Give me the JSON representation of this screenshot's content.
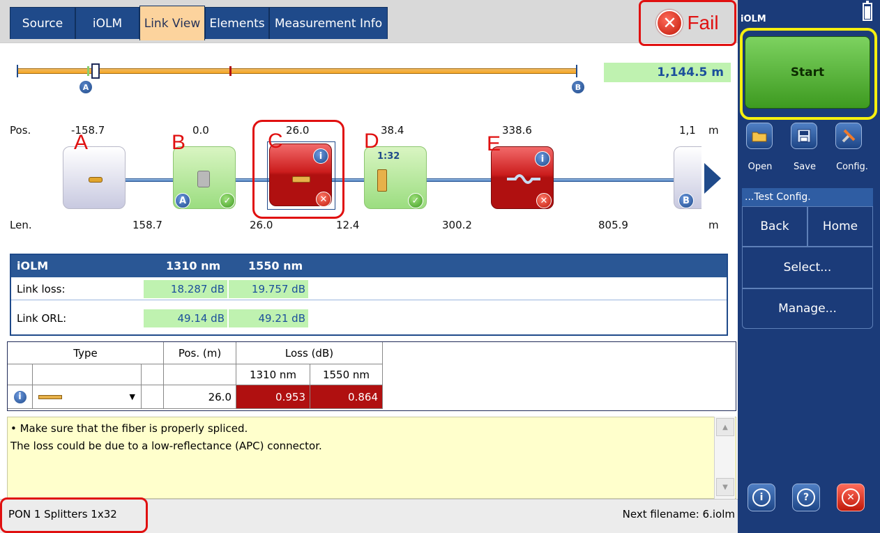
{
  "tabs": [
    "Source",
    "iOLM",
    "Link View",
    "Elements",
    "Measurement Info"
  ],
  "active_tab": "Link View",
  "result": {
    "label": "Fail",
    "icon": "fail-x-icon",
    "color": "#e01010"
  },
  "overview": {
    "distance": "1,144.5 m",
    "markers": [
      "A",
      "B"
    ]
  },
  "diagram": {
    "pos_label": "Pos.",
    "len_label": "Len.",
    "unit": "m",
    "positions": [
      "-158.7",
      "0.0",
      "26.0",
      "38.4",
      "338.6",
      "1,1"
    ],
    "lengths": [
      "158.7",
      "26.0",
      "12.4",
      "300.2",
      "805.9"
    ],
    "callout_letters": [
      "A",
      "B",
      "C",
      "D",
      "E"
    ],
    "splitter_ratio": "1:32",
    "elements": [
      {
        "id": "launch",
        "status": "neutral",
        "icon": "connector-icon"
      },
      {
        "id": "B",
        "status": "pass",
        "icon": "splice-icon",
        "marker": "A"
      },
      {
        "id": "C",
        "status": "fail",
        "icon": "connector-icon"
      },
      {
        "id": "D",
        "status": "pass",
        "icon": "splitter-icon"
      },
      {
        "id": "E",
        "status": "fail",
        "icon": "macrobend-icon"
      },
      {
        "id": "end",
        "status": "neutral",
        "icon": "connector-icon",
        "marker": "B"
      }
    ]
  },
  "summary": {
    "title": "iOLM",
    "wl1": "1310 nm",
    "wl2": "1550 nm",
    "rows": [
      {
        "label": "Link loss:",
        "v1": "18.287 dB",
        "v2": "19.757 dB"
      },
      {
        "label": "Link ORL:",
        "v1": "49.14 dB",
        "v2": "49.21 dB"
      }
    ]
  },
  "details": {
    "col_type": "Type",
    "col_pos": "Pos. (m)",
    "col_loss": "Loss (dB)",
    "col_wl1": "1310 nm",
    "col_wl2": "1550 nm",
    "row": {
      "pos": "26.0",
      "loss1": "0.953",
      "loss2": "0.864"
    }
  },
  "message": {
    "line1": "• Make sure that the fiber is properly spliced.",
    "line2": "The loss could be due to a low-reflectance (APC) connector."
  },
  "status": {
    "config": "PON 1 Splitters 1x32",
    "next_file": "Next filename: 6.iolm"
  },
  "panel": {
    "title": "iOLM",
    "start": "Start",
    "tools": [
      "Open",
      "Save",
      "Config."
    ],
    "menu_header": "...Test Config.",
    "back": "Back",
    "home": "Home",
    "select": "Select...",
    "manage": "Manage..."
  }
}
